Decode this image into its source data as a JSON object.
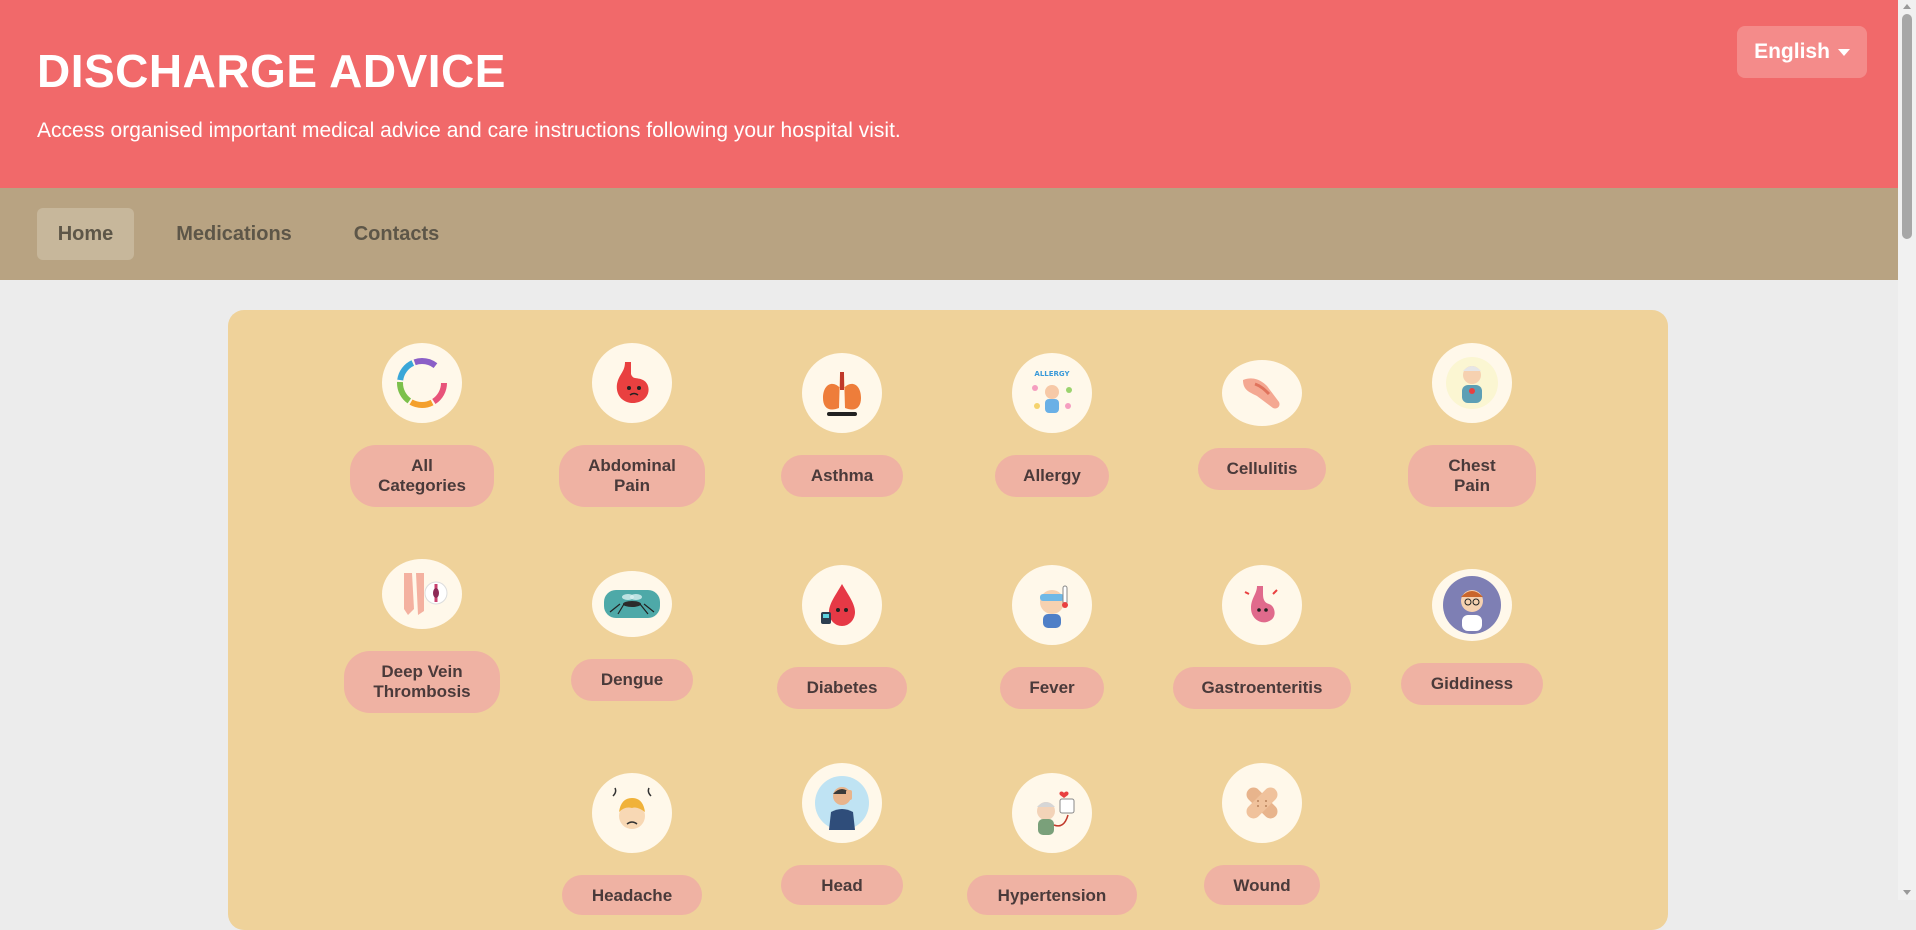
{
  "header": {
    "title": "DISCHARGE ADVICE",
    "subtitle": "Access organised important medical advice and care instructions following your hospital visit.",
    "language": "English"
  },
  "nav": {
    "items": [
      {
        "label": "Home",
        "active": true
      },
      {
        "label": "Medications",
        "active": false
      },
      {
        "label": "Contacts",
        "active": false
      }
    ]
  },
  "categories": [
    {
      "label": "All Categories",
      "icon": "category-ring-icon"
    },
    {
      "label": "Abdominal Pain",
      "icon": "stomach-icon"
    },
    {
      "label": "Asthma",
      "icon": "lungs-icon"
    },
    {
      "label": "Allergy",
      "icon": "allergy-icon"
    },
    {
      "label": "Cellulitis",
      "icon": "leg-icon"
    },
    {
      "label": "Chest Pain",
      "icon": "elderly-chest-pain-icon"
    },
    {
      "label": "Deep Vein Thrombosis",
      "icon": "vein-leg-icon"
    },
    {
      "label": "Dengue",
      "icon": "mosquito-icon"
    },
    {
      "label": "Diabetes",
      "icon": "blood-drop-icon"
    },
    {
      "label": "Fever",
      "icon": "thermometer-child-icon"
    },
    {
      "label": "Gastroenteritis",
      "icon": "gut-icon"
    },
    {
      "label": "Giddiness",
      "icon": "dizzy-person-icon"
    },
    {
      "label": "Headache",
      "icon": "headache-child-icon"
    },
    {
      "label": "Head",
      "icon": "head-injury-icon"
    },
    {
      "label": "Hypertension",
      "icon": "elderly-blood-pressure-icon"
    },
    {
      "label": "Wound",
      "icon": "bandage-icon"
    }
  ],
  "colors": {
    "header_bg": "#f1696a",
    "nav_bg": "#b8a382",
    "panel_bg": "#efd29a",
    "pill_bg": "#efb2a3"
  }
}
